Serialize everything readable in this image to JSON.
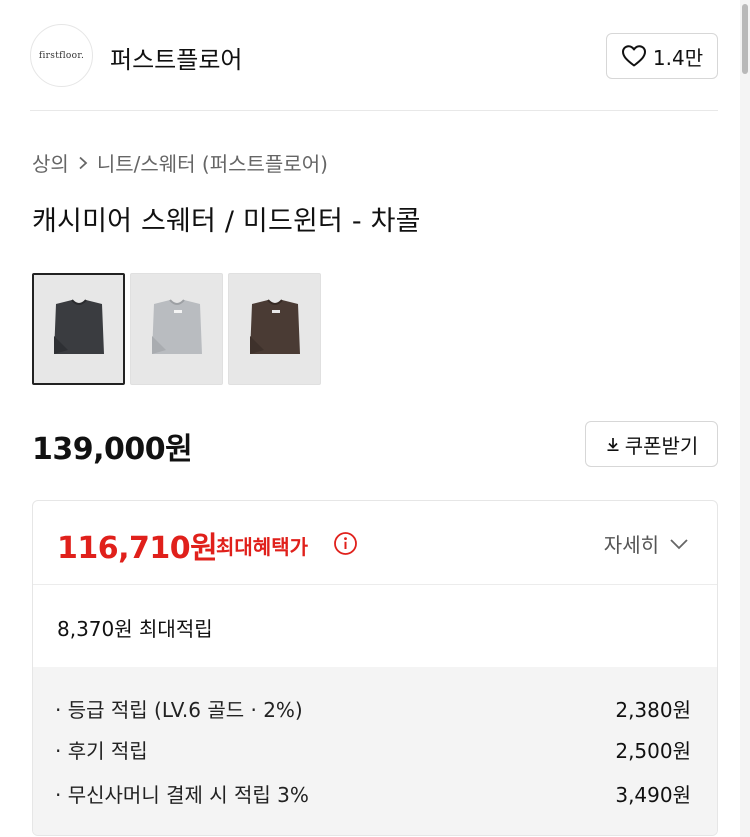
{
  "brand": {
    "logo_text": "firstfloor.",
    "name": "퍼스트플로어",
    "like_count": "1.4만"
  },
  "breadcrumb": {
    "level1": "상의",
    "level2": "니트/스웨터 (퍼스트플로어)"
  },
  "product": {
    "title": "캐시미어 스웨터 / 미드윈터 - 차콜",
    "thumbnails": [
      {
        "color_name": "charcoal",
        "swatch": "#3a3c40",
        "selected": true
      },
      {
        "color_name": "light-grey",
        "swatch": "#b9bcc0",
        "selected": false
      },
      {
        "color_name": "brown",
        "swatch": "#4a3b34",
        "selected": false
      }
    ],
    "price": "139,000원",
    "coupon_label": "쿠폰받기"
  },
  "benefit": {
    "price": "116,710원",
    "label": "최대혜택가",
    "detail_label": "자세히",
    "points_total": "8,370원 최대적립",
    "rows": [
      {
        "label": "· 등급 적립 (LV.6 골드 · 2%)",
        "amount": "2,380원"
      },
      {
        "label": "· 후기 적립",
        "amount": "2,500원"
      },
      {
        "label": "· 무신사머니 결제 시 적립 3%",
        "amount": "3,490원"
      }
    ]
  },
  "colors": {
    "accent_red": "#e0201b",
    "text": "#111111",
    "muted": "#666666",
    "panel": "#f4f4f4"
  }
}
